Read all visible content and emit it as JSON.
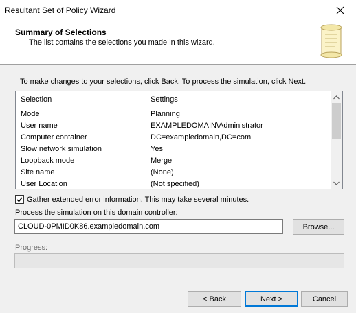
{
  "window": {
    "title": "Resultant Set of Policy Wizard"
  },
  "header": {
    "title": "Summary of Selections",
    "subtitle": "The list contains the selections you made in this wizard."
  },
  "instruction": "To make changes to your selections, click Back. To process the simulation, click Next.",
  "summary": {
    "headers": [
      "Selection",
      "Settings"
    ],
    "rows": [
      [
        "Mode",
        "Planning"
      ],
      [
        "User name",
        "EXAMPLEDOMAIN\\Administrator"
      ],
      [
        "Computer container",
        "DC=exampledomain,DC=com"
      ],
      [
        "Slow network simulation",
        "Yes"
      ],
      [
        "Loopback mode",
        "Merge"
      ],
      [
        "Site name",
        "(None)"
      ],
      [
        "User Location",
        "(Not specified)"
      ]
    ]
  },
  "options": {
    "gather_extended_label": "Gather extended error information. This may take several minutes.",
    "gather_extended_checked": true
  },
  "domain_controller": {
    "label": "Process the simulation on this domain controller:",
    "value": "CLOUD-0PMID0K86.exampledomain.com",
    "browse_label": "Browse..."
  },
  "progress": {
    "label": "Progress:",
    "value": 0
  },
  "buttons": {
    "back": "< Back",
    "next": "Next >",
    "cancel": "Cancel"
  },
  "icons": {
    "close": "close-icon",
    "header": "scroll-icon",
    "check": "checkmark-icon"
  }
}
